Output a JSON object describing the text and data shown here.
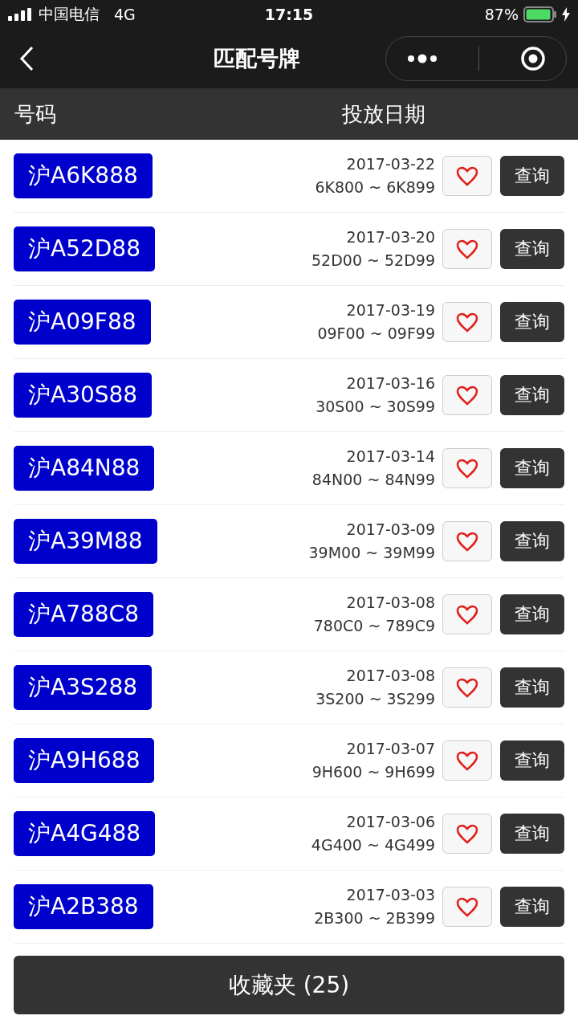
{
  "status_bar": {
    "carrier": "中国电信",
    "network": "4G",
    "time": "17:15",
    "battery": "87%"
  },
  "nav": {
    "title": "匹配号牌"
  },
  "columns": [
    "号码",
    "投放日期"
  ],
  "rows": [
    {
      "plate": "沪A6K888",
      "date": "2017-03-22",
      "range": "6K800 ~ 6K899",
      "action": "查询"
    },
    {
      "plate": "沪A52D88",
      "date": "2017-03-20",
      "range": "52D00 ~ 52D99",
      "action": "查询"
    },
    {
      "plate": "沪A09F88",
      "date": "2017-03-19",
      "range": "09F00 ~ 09F99",
      "action": "查询"
    },
    {
      "plate": "沪A30S88",
      "date": "2017-03-16",
      "range": "30S00 ~ 30S99",
      "action": "查询"
    },
    {
      "plate": "沪A84N88",
      "date": "2017-03-14",
      "range": "84N00 ~ 84N99",
      "action": "查询"
    },
    {
      "plate": "沪A39M88",
      "date": "2017-03-09",
      "range": "39M00 ~ 39M99",
      "action": "查询"
    },
    {
      "plate": "沪A788C8",
      "date": "2017-03-08",
      "range": "780C0 ~ 789C9",
      "action": "查询"
    },
    {
      "plate": "沪A3S288",
      "date": "2017-03-08",
      "range": "3S200 ~ 3S299",
      "action": "查询"
    },
    {
      "plate": "沪A9H688",
      "date": "2017-03-07",
      "range": "9H600 ~ 9H699",
      "action": "查询"
    },
    {
      "plate": "沪A4G488",
      "date": "2017-03-06",
      "range": "4G400 ~ 4G499",
      "action": "查询"
    },
    {
      "plate": "沪A2B388",
      "date": "2017-03-03",
      "range": "2B300 ~ 2B399",
      "action": "查询"
    }
  ],
  "footer": {
    "button": "收藏夹 (25)"
  }
}
